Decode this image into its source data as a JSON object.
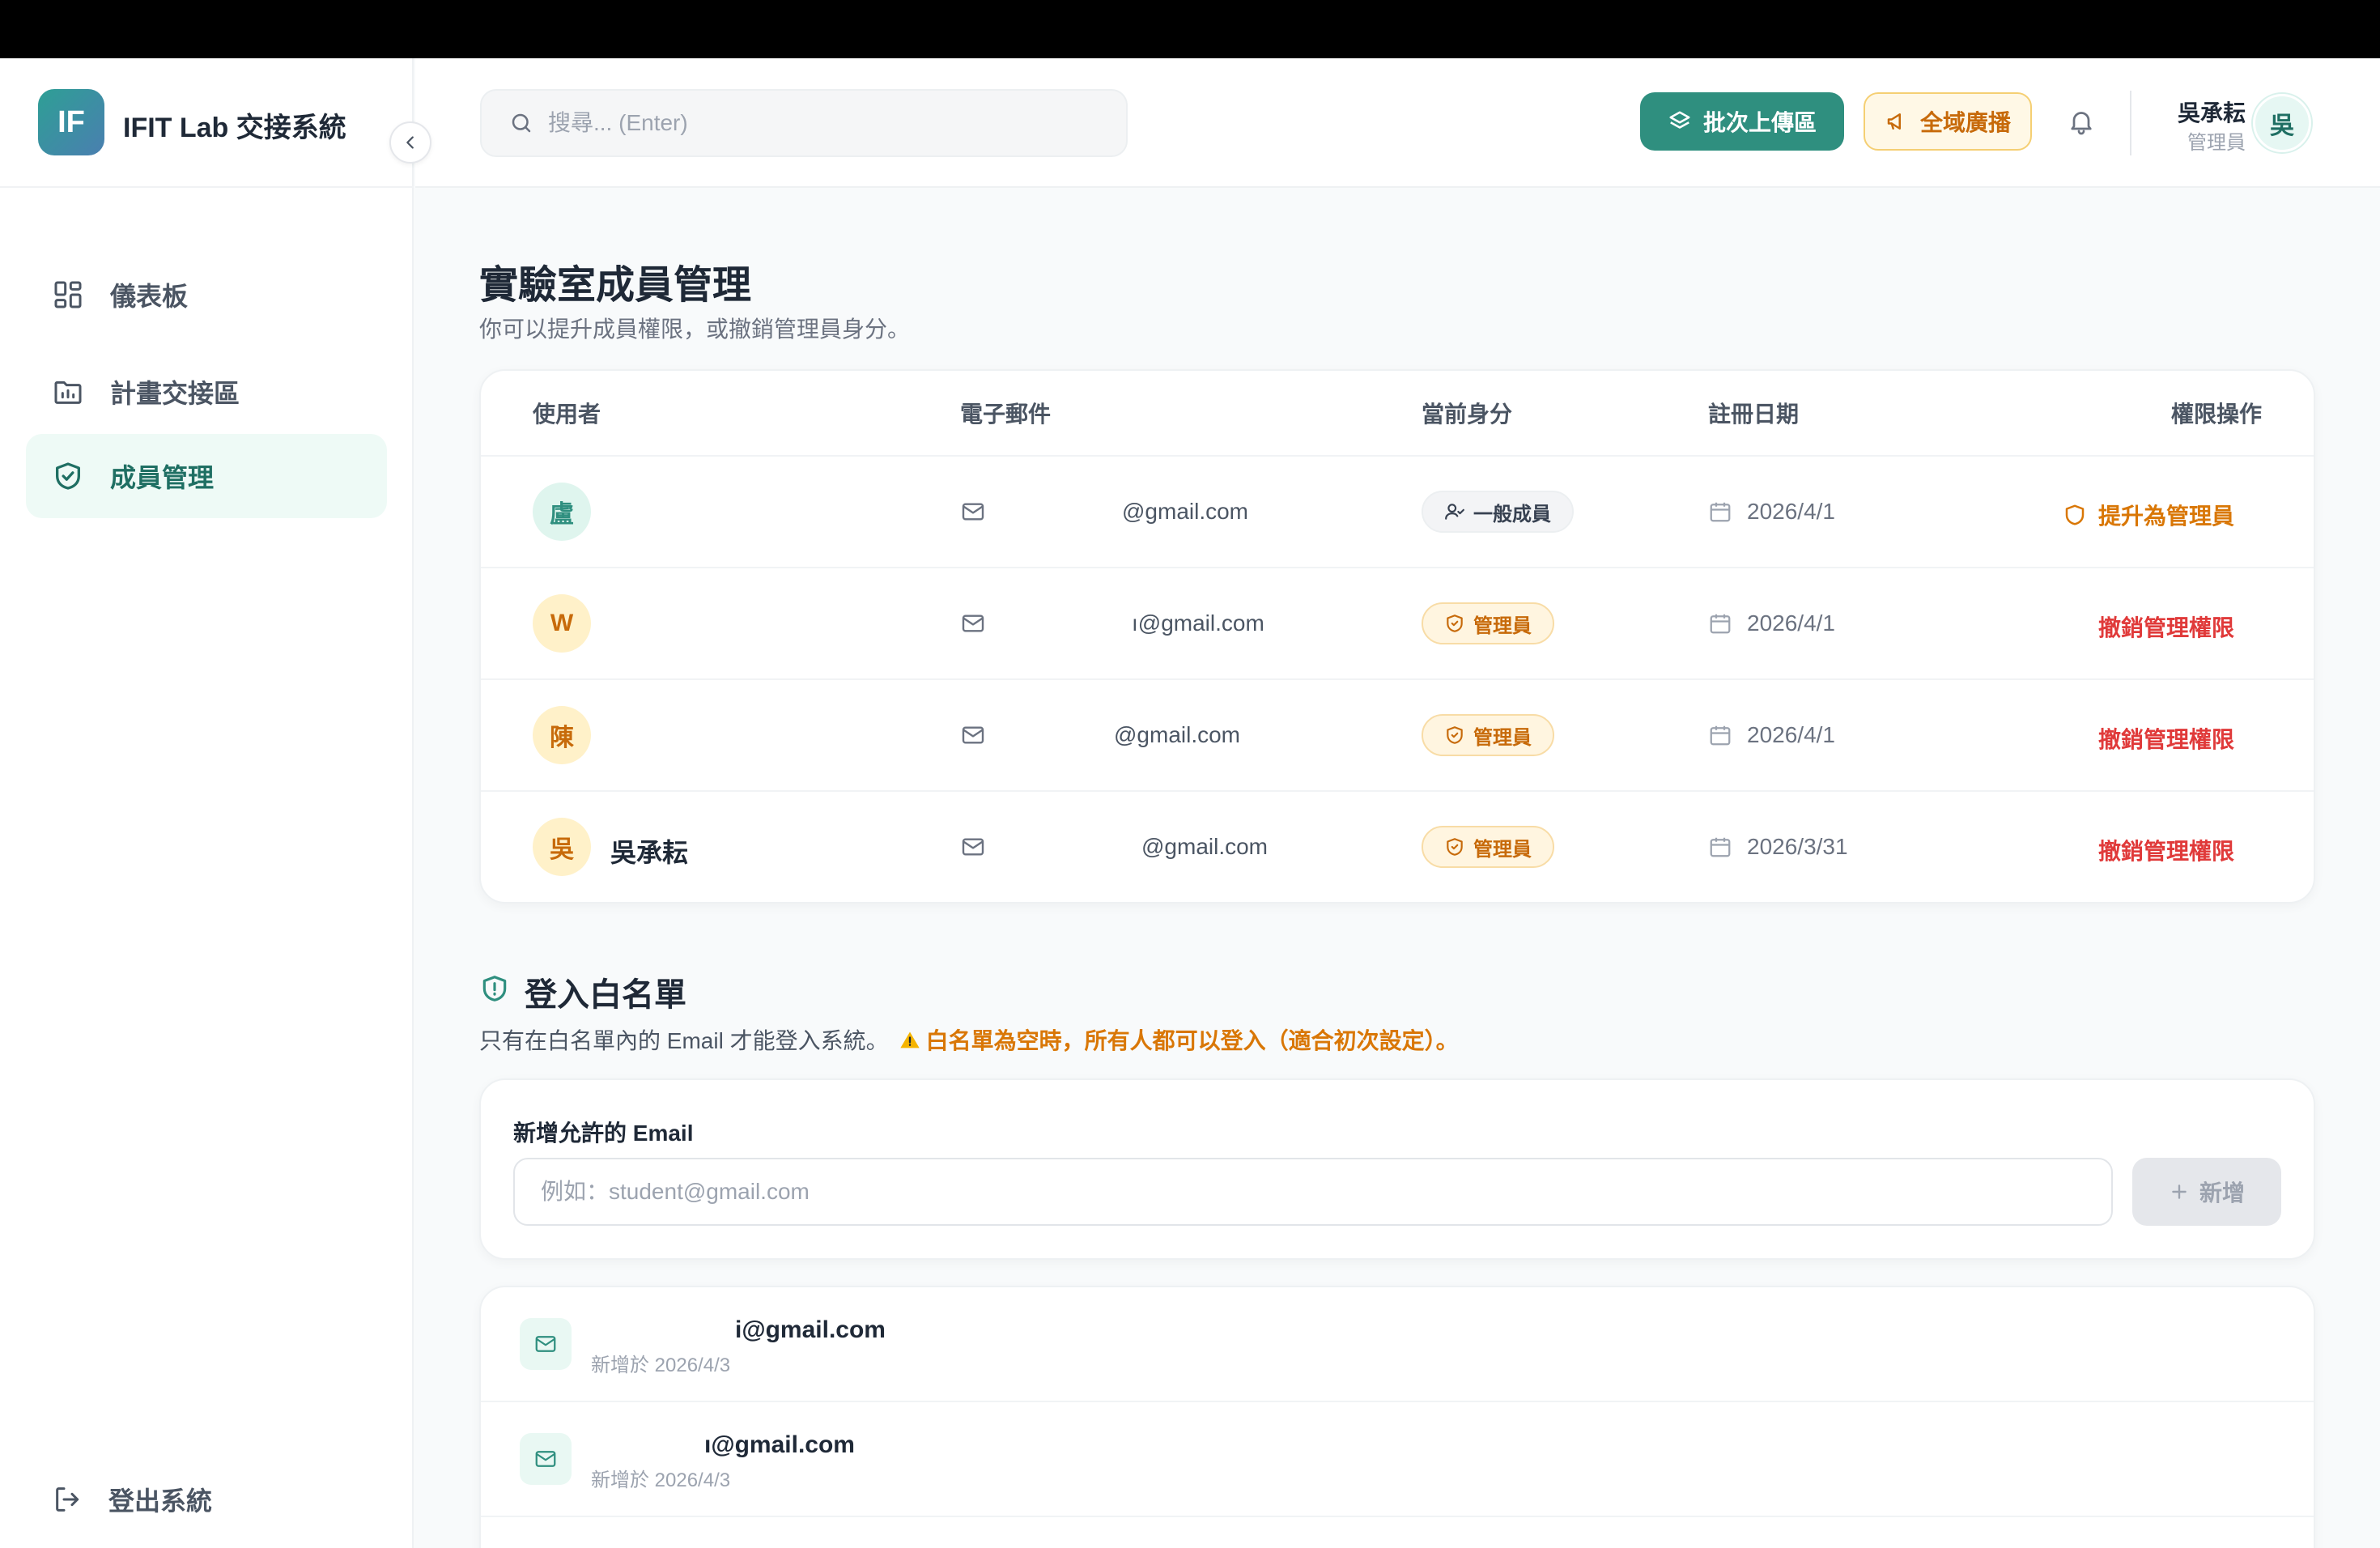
{
  "app": {
    "logo_text": "IF",
    "title": "IFIT Lab 交接系統"
  },
  "sidebar": {
    "items": [
      {
        "label": "儀表板",
        "icon": "dashboard-grid-icon",
        "active": false
      },
      {
        "label": "計畫交接區",
        "icon": "folder-chart-icon",
        "active": false
      },
      {
        "label": "成員管理",
        "icon": "shield-check-icon",
        "active": true
      }
    ],
    "logout_label": "登出系統"
  },
  "header": {
    "search_placeholder": "搜尋... (Enter)",
    "batch_upload_label": "批次上傳區",
    "broadcast_label": "全域廣播",
    "user": {
      "name": "吳承耘",
      "role": "管理員",
      "avatar_text": "吳"
    }
  },
  "page": {
    "title": "實驗室成員管理",
    "subtitle": "你可以提升成員權限，或撤銷管理員身分。"
  },
  "members_table": {
    "columns": [
      "使用者",
      "電子郵件",
      "當前身分",
      "註冊日期",
      "權限操作"
    ],
    "rows": [
      {
        "avatar": "盧",
        "name": "",
        "email": "@gmail.com",
        "role": "一般成員",
        "date": "2026/4/1",
        "action": "提升為管理員"
      },
      {
        "avatar": "W",
        "name": "",
        "email": "ı@gmail.com",
        "role": "管理員",
        "date": "2026/4/1",
        "action": "撤銷管理權限"
      },
      {
        "avatar": "陳",
        "name": "",
        "email": "@gmail.com",
        "role": "管理員",
        "date": "2026/4/1",
        "action": "撤銷管理權限"
      },
      {
        "avatar": "吳",
        "name": "吳承耘",
        "email": "@gmail.com",
        "role": "管理員",
        "date": "2026/3/31",
        "action": "撤銷管理權限"
      }
    ]
  },
  "whitelist": {
    "title": "登入白名單",
    "description": "只有在白名單內的 Email 才能登入系統。",
    "warning": "白名單為空時，所有人都可以登入（適合初次設定）。",
    "add_label": "新增允許的 Email",
    "add_placeholder": "例如：student@gmail.com",
    "add_button": "新增",
    "entries": [
      {
        "email": "i@gmail.com",
        "added": "新增於 2026/4/3"
      },
      {
        "email": "ı@gmail.com",
        "added": "新增於 2026/4/3"
      }
    ]
  },
  "colors": {
    "brand": "#2f8f7f",
    "warning": "#d97706",
    "danger": "#e03a3a"
  }
}
